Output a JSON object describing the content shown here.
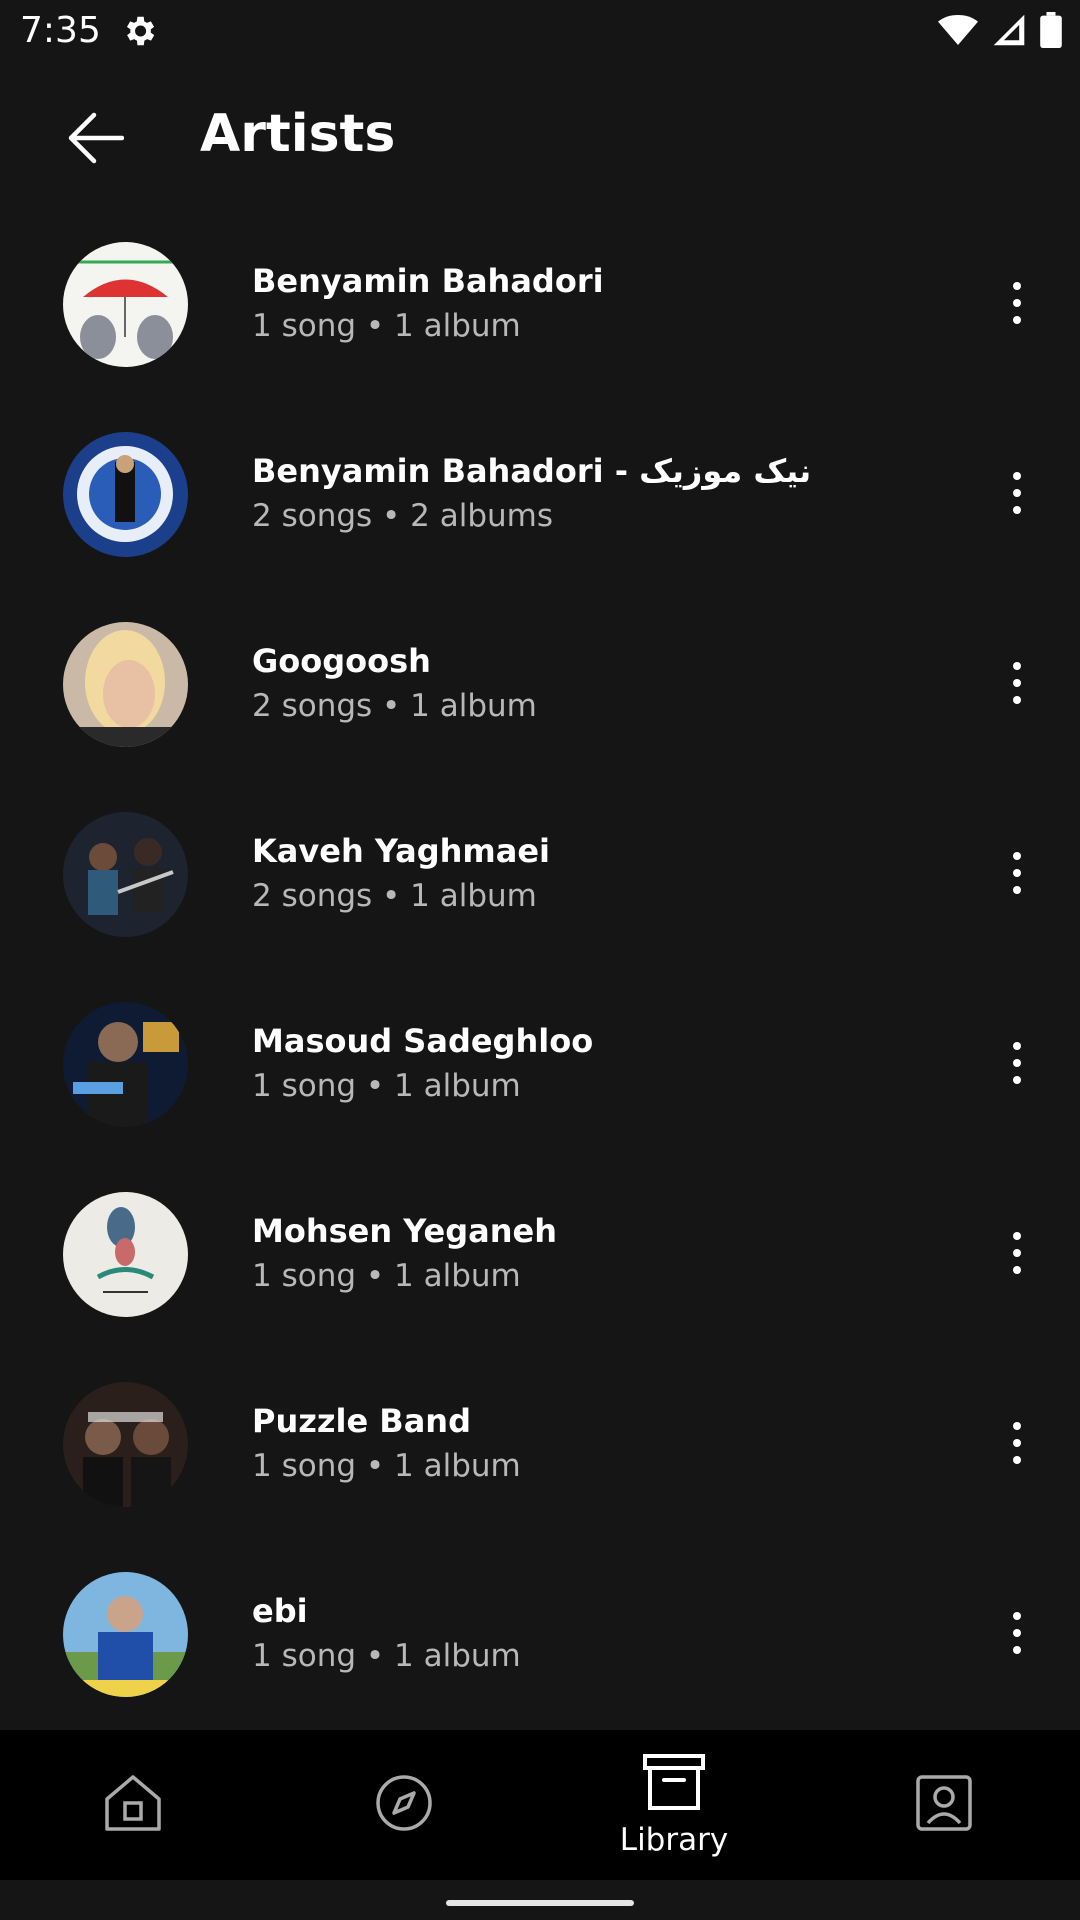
{
  "status_bar": {
    "time": "7:35",
    "icons": [
      "settings-icon",
      "wifi-icon",
      "cell-signal-icon",
      "battery-icon"
    ]
  },
  "header": {
    "title": "Artists",
    "back_icon": "arrow-back-icon"
  },
  "artists": [
    {
      "name": "Benyamin Bahadori",
      "meta": "1 song • 1 album"
    },
    {
      "name": "Benyamin Bahadori - نیک موزیک",
      "meta": "2 songs • 2 albums"
    },
    {
      "name": "Googoosh",
      "meta": "2 songs • 1 album"
    },
    {
      "name": "Kaveh Yaghmaei",
      "meta": "2 songs • 1 album"
    },
    {
      "name": "Masoud Sadeghloo",
      "meta": "1 song • 1 album"
    },
    {
      "name": "Mohsen Yeganeh",
      "meta": "1 song • 1 album"
    },
    {
      "name": "Puzzle Band",
      "meta": "1 song • 1 album"
    },
    {
      "name": "ebi",
      "meta": "1 song • 1 album"
    }
  ],
  "bottom_nav": {
    "items": [
      {
        "icon": "home-icon",
        "label": ""
      },
      {
        "icon": "explore-compass-icon",
        "label": ""
      },
      {
        "icon": "library-icon",
        "label": "Library",
        "selected": true
      },
      {
        "icon": "profile-icon",
        "label": ""
      }
    ]
  },
  "colors": {
    "background": "#151515",
    "nav_background": "#000000",
    "primary_text": "#ffffff",
    "secondary_text": "#b8b8b8"
  }
}
